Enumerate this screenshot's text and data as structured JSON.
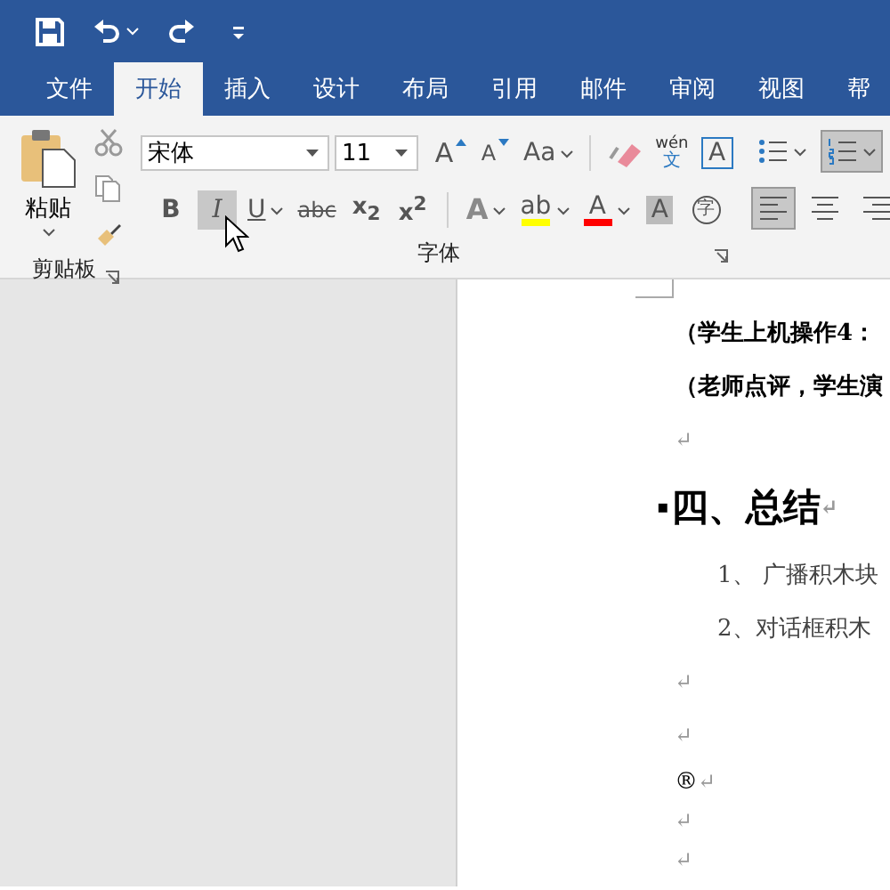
{
  "quick_access": [
    {
      "kind": "save"
    },
    {
      "kind": "undo",
      "dropdown": true
    },
    {
      "kind": "redo"
    },
    {
      "kind": "customize"
    }
  ],
  "tabs": [
    {
      "label": "文件",
      "selected": false
    },
    {
      "label": "开始",
      "selected": true
    },
    {
      "label": "插入",
      "selected": false
    },
    {
      "label": "设计",
      "selected": false
    },
    {
      "label": "布局",
      "selected": false
    },
    {
      "label": "引用",
      "selected": false
    },
    {
      "label": "邮件",
      "selected": false
    },
    {
      "label": "审阅",
      "selected": false
    },
    {
      "label": "视图",
      "selected": false
    },
    {
      "label": "帮",
      "selected": false
    }
  ],
  "clipboard": {
    "paste_label": "粘贴",
    "group_label": "剪贴板"
  },
  "font": {
    "font_name": "宋体",
    "font_size": "11",
    "group_label": "字体",
    "row1": [
      {
        "kind": "grow",
        "label": "A",
        "selected": false
      },
      {
        "kind": "shrink",
        "label": "A",
        "selected": false
      },
      {
        "kind": "case",
        "label": "Aa",
        "selected": false
      },
      {
        "kind": "separator"
      },
      {
        "kind": "clear",
        "selected": false
      },
      {
        "kind": "phonetic",
        "label": "wén",
        "sub": "文",
        "selected": false
      },
      {
        "kind": "border",
        "label": "A",
        "selected": false
      }
    ],
    "row2": [
      {
        "kind": "bold",
        "label": "B",
        "selected": false
      },
      {
        "kind": "italic",
        "label": "I",
        "selected": true
      },
      {
        "kind": "underline",
        "label": "U",
        "selected": false
      },
      {
        "kind": "strike",
        "label": "abc",
        "selected": false
      },
      {
        "kind": "script",
        "label": "x$_{2}$",
        "selected": false
      },
      {
        "kind": "script",
        "label": "x$^{2}$",
        "selected": false
      },
      {
        "kind": "separator"
      },
      {
        "kind": "effect",
        "label": "A",
        "selected": false
      },
      {
        "kind": "highlight",
        "label": "ab",
        "color": "#ffff00",
        "selected": false
      },
      {
        "kind": "fontcolor",
        "label": "A",
        "color": "#ff0000",
        "selected": false
      },
      {
        "kind": "shading",
        "label": "A",
        "selected": false
      },
      {
        "kind": "enclose",
        "label": "字",
        "selected": false
      }
    ]
  },
  "paragraph": {
    "row1": [
      {
        "kind": "bullets",
        "selected": false
      },
      {
        "kind": "numbering",
        "selected": true
      }
    ],
    "row2": [
      {
        "kind": "left",
        "selected": true
      },
      {
        "kind": "center",
        "selected": false
      },
      {
        "kind": "right",
        "selected": false
      }
    ]
  },
  "document": {
    "lines": [
      {
        "kind": "text",
        "text": "（学生上机操作4：",
        "bold": true
      },
      {
        "kind": "text",
        "text": "（老师点评，学生演",
        "bold": true
      },
      {
        "kind": "mark",
        "text": "↵"
      },
      {
        "kind": "heading",
        "marker": "▪",
        "text": "四、总结",
        "mark": "↵"
      },
      {
        "kind": "list",
        "text": "1、 广播积木块"
      },
      {
        "kind": "list",
        "text": "2、对话框积木"
      },
      {
        "kind": "mark",
        "text": "↵"
      },
      {
        "kind": "mark",
        "text": "↵"
      },
      {
        "kind": "text",
        "text": "®",
        "mark": "↵"
      },
      {
        "kind": "mark",
        "text": "↵"
      },
      {
        "kind": "mark",
        "text": "↵"
      }
    ]
  }
}
